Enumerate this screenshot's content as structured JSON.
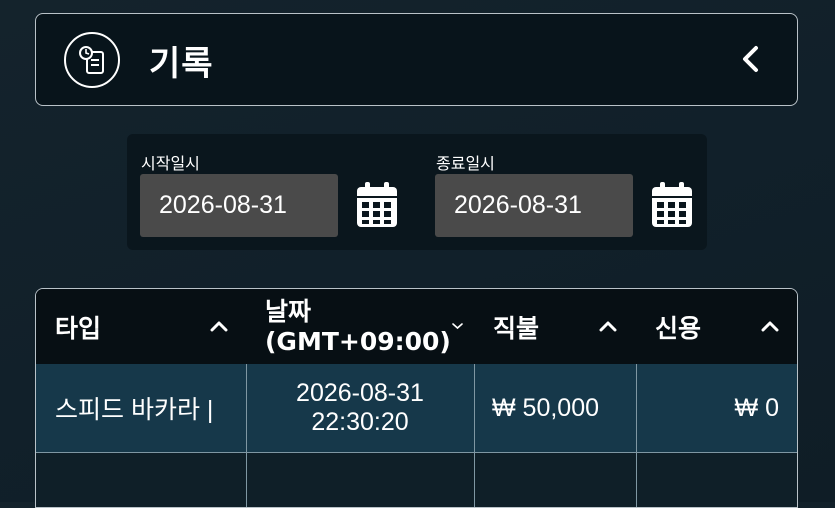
{
  "header": {
    "title": "기록",
    "icon": "clipboard-history-icon",
    "back_icon": "chevron-left-icon"
  },
  "date_filter": {
    "start_label": "시작일시",
    "start_value": "2026-08-31",
    "end_label": "종료일시",
    "end_value": "2026-08-31",
    "calendar_icon": "calendar-icon"
  },
  "table": {
    "columns": [
      {
        "label": "타입",
        "sort_icon": "caret-up-icon"
      },
      {
        "label_line1": "날짜",
        "label_line2": "(GMT+09:00)",
        "sort_icon": "caret-down-icon"
      },
      {
        "label": "직불",
        "sort_icon": "caret-up-icon"
      },
      {
        "label": "신용",
        "sort_icon": "caret-up-icon"
      }
    ],
    "rows": [
      {
        "type": "스피드 바카라 |",
        "date": "2026-08-31",
        "time": "22:30:20",
        "debit": "₩ 50,000",
        "credit": "₩ 0"
      }
    ]
  },
  "colors": {
    "header_bg": "#08141b",
    "row_bg": "#16384a",
    "input_bg": "#4a4a4a"
  }
}
